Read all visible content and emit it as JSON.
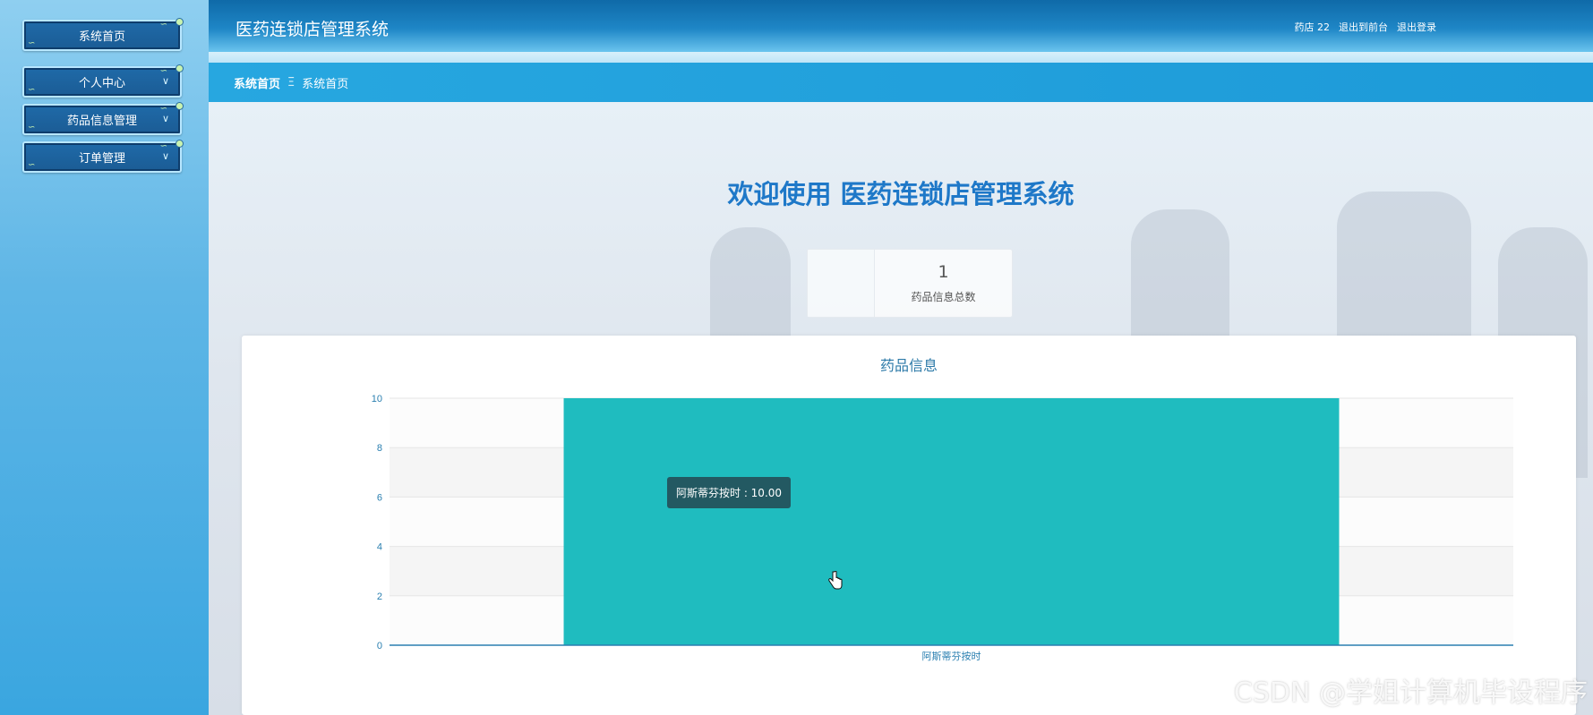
{
  "sidebar": {
    "items": [
      {
        "label": "系统首页",
        "has_chevron": false
      },
      {
        "label": "个人中心",
        "has_chevron": true
      },
      {
        "label": "药品信息管理",
        "has_chevron": true
      },
      {
        "label": "订单管理",
        "has_chevron": true
      }
    ]
  },
  "header": {
    "title": "医药连锁店管理系统",
    "user": "药店 22",
    "back_to_front": "退出到前台",
    "logout": "退出登录"
  },
  "breadcrumb": {
    "first": "系统首页",
    "separator": "Ξ",
    "current": "系统首页"
  },
  "main": {
    "welcome": "欢迎使用 医药连锁店管理系统",
    "stat": {
      "value": "1",
      "label": "药品信息总数"
    },
    "chart_title": "药品信息",
    "tooltip": "阿斯蒂芬按时 : 10.00"
  },
  "watermark": "CSDN @学姐计算机毕设程序",
  "colors": {
    "accent": "#1e78c8",
    "bar": "#1fbcbf",
    "axis": "#2a7fb0"
  },
  "chart_data": {
    "type": "bar",
    "categories": [
      "阿斯蒂芬按时"
    ],
    "values": [
      10
    ],
    "title": "药品信息",
    "xlabel": "",
    "ylabel": "",
    "ylim": [
      0,
      10
    ],
    "yticks": [
      0,
      2,
      4,
      6,
      8,
      10
    ],
    "grid": true,
    "legend": "none"
  }
}
